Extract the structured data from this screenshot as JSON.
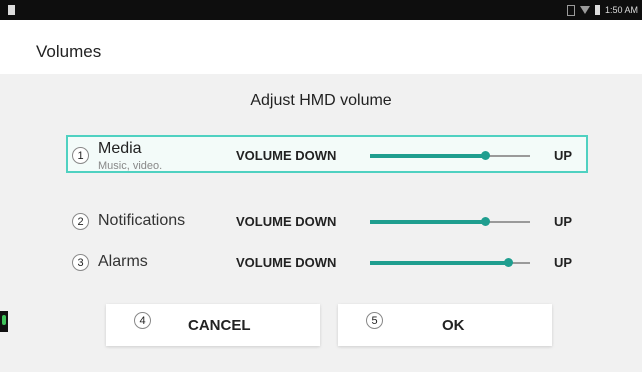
{
  "status_bar": {
    "time": "1:50 AM",
    "icons": [
      "sim-icon",
      "wifi-icon",
      "battery-icon"
    ]
  },
  "header": {
    "title": "Volumes"
  },
  "dialog": {
    "title": "Adjust HMD volume",
    "rows": [
      {
        "number": "1",
        "label": "Media",
        "subtitle": "Music, video.",
        "down_label": "VOLUME DOWN",
        "up_label": "UP",
        "level": 0.72,
        "selected": true
      },
      {
        "number": "2",
        "label": "Notifications",
        "subtitle": "",
        "down_label": "VOLUME DOWN",
        "up_label": "UP",
        "level": 0.72,
        "selected": false
      },
      {
        "number": "3",
        "label": "Alarms",
        "subtitle": "",
        "down_label": "VOLUME DOWN",
        "up_label": "UP",
        "level": 0.86,
        "selected": false
      }
    ],
    "buttons": {
      "cancel": {
        "number": "4",
        "label": "CANCEL"
      },
      "ok": {
        "number": "5",
        "label": "OK"
      }
    }
  },
  "colors": {
    "accent": "#1f9e8f",
    "selection_border": "#4fd1c1",
    "mic_indicator": "#3fc35a"
  },
  "side_indicator": {
    "icon": "mic-icon"
  }
}
